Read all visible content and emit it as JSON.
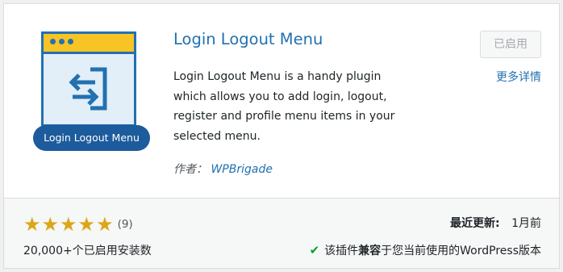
{
  "plugin": {
    "name": "Login Logout Menu",
    "icon_badge_text": "Login Logout Menu",
    "description": "Login Logout Menu is a handy plugin which allows you to add login, logout, register and profile menu items in your selected menu.",
    "author_label": "作者：",
    "author_name": "WPBrigade"
  },
  "actions": {
    "activated_label": "已启用",
    "more_details_label": "更多详情"
  },
  "footer": {
    "rating_stars": 5,
    "rating_count": "(9)",
    "installs": "20,000+个已启用安装数",
    "last_updated_label": "最近更新:",
    "last_updated_value": "1月前",
    "compat_prefix": "该插件",
    "compat_bold": "兼容",
    "compat_suffix": "于您当前使用的WordPress版本"
  },
  "colors": {
    "link_blue": "#2271b1",
    "star_gold": "#dba617",
    "check_green": "#00a32a",
    "icon_yellow": "#f7c325"
  }
}
